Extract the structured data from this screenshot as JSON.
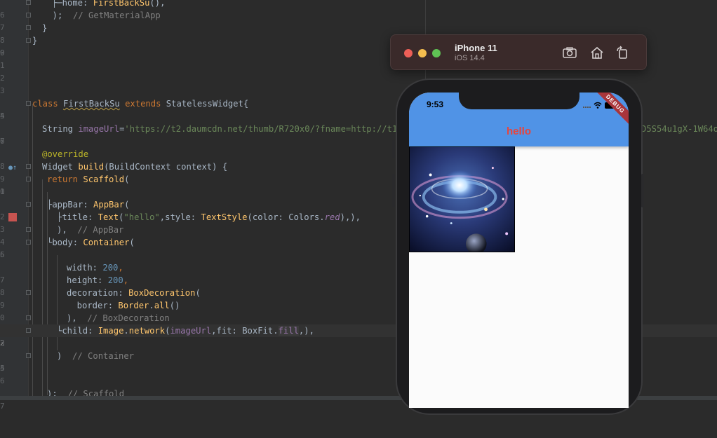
{
  "editor": {
    "line_numbers": [
      "6",
      "7",
      "8",
      "9",
      "0",
      "1",
      "2",
      "3",
      "4",
      "5",
      "6",
      "7",
      "8",
      "9",
      "0",
      "1",
      "2",
      "3",
      "4",
      "5",
      "6",
      "7",
      "8",
      "9",
      "0",
      "1",
      "2",
      "3",
      "4",
      "5",
      "6",
      "7",
      "8"
    ],
    "code_fragments": {
      "l1_a": "├─home: ",
      "l1_b": "FirstBackSu",
      "l1_c": "(),",
      "l2_a": "  );  ",
      "l2_b": "// GetMaterialApp",
      "l3": "}",
      "l4": "}",
      "l9_kw1": "class ",
      "l9_name": "FirstBackSu",
      "l9_kw2": " extends ",
      "l9_rest": "StatelessWidget{",
      "l11_a": "String ",
      "l11_fld": "imageUrl",
      "l11_eq": "=",
      "l11_str": "'https://t2.daumcdn.net/thumb/R720x0/?fname=http://t1.da",
      "l11_tail": "D5S54u1gX-1W64o",
      "l13": "@override",
      "l14_a": "Widget ",
      "l14_fn": "build",
      "l14_c": "(BuildContext context) {",
      "l15_kw": "return ",
      "l15_fn": "Scaffold",
      "l15_c": "(",
      "l17_a": "appBar: ",
      "l17_fn": "AppBar",
      "l17_c": "(",
      "l18_a": "├title: ",
      "l18_fn": "Text",
      "l18_p": "(",
      "l18_str": "\"hello\"",
      "l18_b": ",style: ",
      "l18_fn2": "TextStyle",
      "l18_c": "(color: Colors.",
      "l18_red": "red",
      "l18_d": "),),",
      "l19_a": "),  ",
      "l19_cmt": "// AppBar",
      "l20_a": "body: ",
      "l20_fn": "Container",
      "l20_c": "(",
      "l22_a": "width: ",
      "l22_num": "200",
      "l22_c": ",",
      "l23_a": "height: ",
      "l23_num": "200",
      "l23_c": ",",
      "l24_a": "decoration: ",
      "l24_fn": "BoxDecoration",
      "l24_c": "(",
      "l25_a": "  border: ",
      "l25_fn": "Border",
      "l25_dot": ".",
      "l25_fn2": "all",
      "l25_c": "()",
      "l26_a": "),  ",
      "l26_cmt": "// BoxDecoration",
      "l27_a": "child: ",
      "l27_fn": "Image",
      "l27_dot": ".",
      "l27_fn2": "network",
      "l27_p": "(",
      "l27_fld": "imageUrl",
      "l27_b": ",fit: BoxFit.",
      "l27_hl": "fill",
      "l27_c": ",),",
      "l29_a": ")  ",
      "l29_cmt": "// Container",
      "l32_a": ");  ",
      "l32_cmt": "// Scaffold"
    }
  },
  "simulator": {
    "device_name": "iPhone 11",
    "os_version": "iOS 14.4",
    "screenshot_icon": "camera-icon",
    "home_icon": "home-icon",
    "rotate_icon": "rotate-icon"
  },
  "app": {
    "status_time": "9:53",
    "appbar_title": "hello",
    "debug_banner": "DEBUG",
    "colors": {
      "appbar": "#5093e6",
      "title": "#e8453c",
      "banner": "#a9353b"
    }
  }
}
